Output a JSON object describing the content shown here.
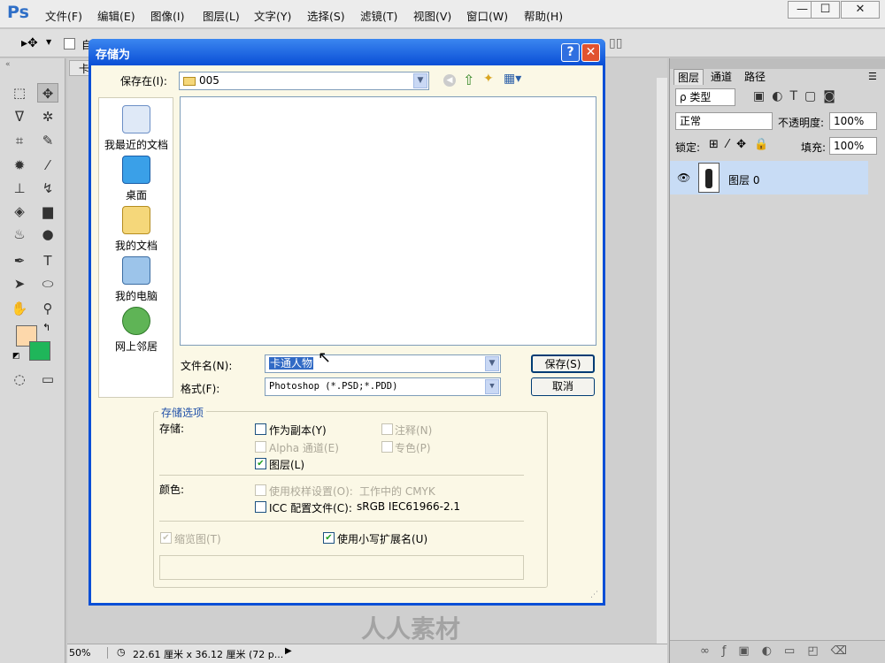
{
  "app": {
    "logo": "Ps",
    "menus": [
      "文件(F)",
      "编辑(E)",
      "图像(I)",
      "图层(L)",
      "文字(Y)",
      "选择(S)",
      "滤镜(T)",
      "视图(V)",
      "窗口(W)",
      "帮助(H)"
    ],
    "window_buttons": [
      "—",
      "☐",
      "✕"
    ]
  },
  "optbar": {
    "auto_label": "自"
  },
  "doc_tab": "卡",
  "status": {
    "zoom": "50%",
    "info": "22.61 厘米 x 36.12 厘米 (72 p..."
  },
  "layers_panel": {
    "tabs": [
      "图层",
      "通道",
      "路径"
    ],
    "filter": "ρ 类型",
    "blend": "正常",
    "opacity_label": "不透明度:",
    "opacity": "100%",
    "lock_label": "锁定:",
    "fill_label": "填充:",
    "fill": "100%",
    "layer_name": "图层 0"
  },
  "dialog": {
    "title": "存储为",
    "help": "?",
    "close": "✕",
    "save_in_label": "保存在(I):",
    "save_in_value": "005",
    "places": [
      "我最近的文档",
      "桌面",
      "我的文档",
      "我的电脑",
      "网上邻居"
    ],
    "filename_label": "文件名(N):",
    "filename_value": "卡通人物",
    "format_label": "格式(F):",
    "format_value": "Photoshop (*.PSD;*.PDD)",
    "save_button": "保存(S)",
    "cancel_button": "取消",
    "options_title": "存储选项",
    "save_label": "存储:",
    "as_copy": "作为副本(Y)",
    "notes": "注释(N)",
    "alpha": "Alpha 通道(E)",
    "spot": "专色(P)",
    "layers": "图层(L)",
    "color_label": "颜色:",
    "proof": "使用校样设置(O):",
    "proof_value": "工作中的 CMYK",
    "icc": "ICC 配置文件(C):",
    "icc_value": "sRGB IEC61966-2.1",
    "thumbnail": "缩览图(T)",
    "lowercase": "使用小写扩展名(U)"
  },
  "watermark": "人人素材"
}
